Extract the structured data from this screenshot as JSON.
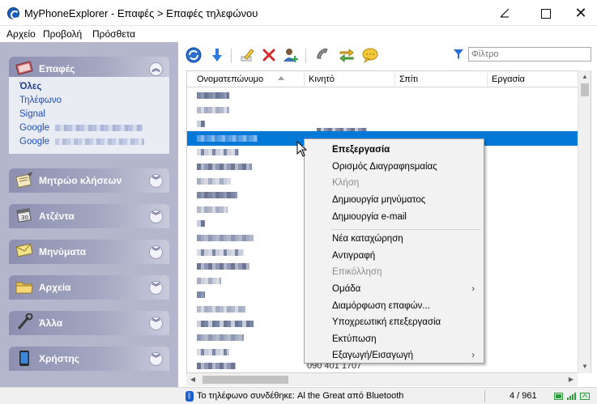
{
  "window": {
    "title": "MyPhoneExplorer -  Επαφές > Επαφές τηλεφώνου"
  },
  "menu": [
    "Αρχείο",
    "Προβολή",
    "Πρόσθετα"
  ],
  "sidebar": {
    "groups": [
      {
        "title": "Επαφές",
        "icon": "contacts-book-icon",
        "expanded": true
      },
      {
        "title": "Μητρώο κλήσεων",
        "icon": "call-log-icon",
        "expanded": false
      },
      {
        "title": "Ατζέντα",
        "icon": "calendar-icon",
        "expanded": false
      },
      {
        "title": "Μηνύματα",
        "icon": "envelope-icon",
        "expanded": false
      },
      {
        "title": "Αρχεία",
        "icon": "folder-icon",
        "expanded": false
      },
      {
        "title": "Άλλα",
        "icon": "tools-icon",
        "expanded": false
      },
      {
        "title": "Χρήστης",
        "icon": "phone-device-icon",
        "expanded": false
      }
    ],
    "contact_filters": [
      "Όλες",
      "Τηλέφωνο",
      "Signal",
      "Google",
      "Google"
    ]
  },
  "toolbar": {
    "icons": [
      "refresh-icon",
      "download-icon",
      "edit-icon",
      "delete-icon",
      "add-contact-icon",
      "call-icon",
      "sync-icon",
      "message-icon"
    ],
    "filter_placeholder": "Φίλτρο"
  },
  "table": {
    "columns": [
      "Ονοματεπώνυμο",
      "Κινητό",
      "Σπίτι",
      "Εργασία"
    ],
    "last_row_phone": "090 401 1707",
    "selected_row": 3
  },
  "context_menu": {
    "items": [
      {
        "label": "Επεξεργασία",
        "style": "bold"
      },
      {
        "label": "Ορισμός Διαγραφηsμαίας",
        "style": "normal"
      },
      {
        "label": "Κλήση",
        "style": "disabled"
      },
      {
        "label": "Δημιουργία μηνύματος",
        "style": "normal"
      },
      {
        "label": "Δημιουργία e-mail",
        "style": "normal"
      },
      {
        "label": "Νέα καταχώρηση",
        "style": "normal"
      },
      {
        "label": "Αντιγραφή",
        "style": "normal"
      },
      {
        "label": "Επικόλληση",
        "style": "disabled"
      },
      {
        "label": "Ομάδα",
        "style": "submenu"
      },
      {
        "label": "Διαμόρφωση επαφών...",
        "style": "normal"
      },
      {
        "label": "Υποχρεωτική επεξεργασία",
        "style": "normal"
      },
      {
        "label": "Εκτύπωση",
        "style": "normal"
      },
      {
        "label": "Εξαγωγή/Εισαγωγή",
        "style": "submenu"
      }
    ]
  },
  "status": {
    "text": "Το τηλέφωνο συνδέθηκε:  Al the Great από Bluetooth",
    "count": "4 / 961"
  },
  "colors": {
    "selection": "#0078d7",
    "sidebar": "#b4b7cc",
    "link": "#1e4fb8"
  }
}
